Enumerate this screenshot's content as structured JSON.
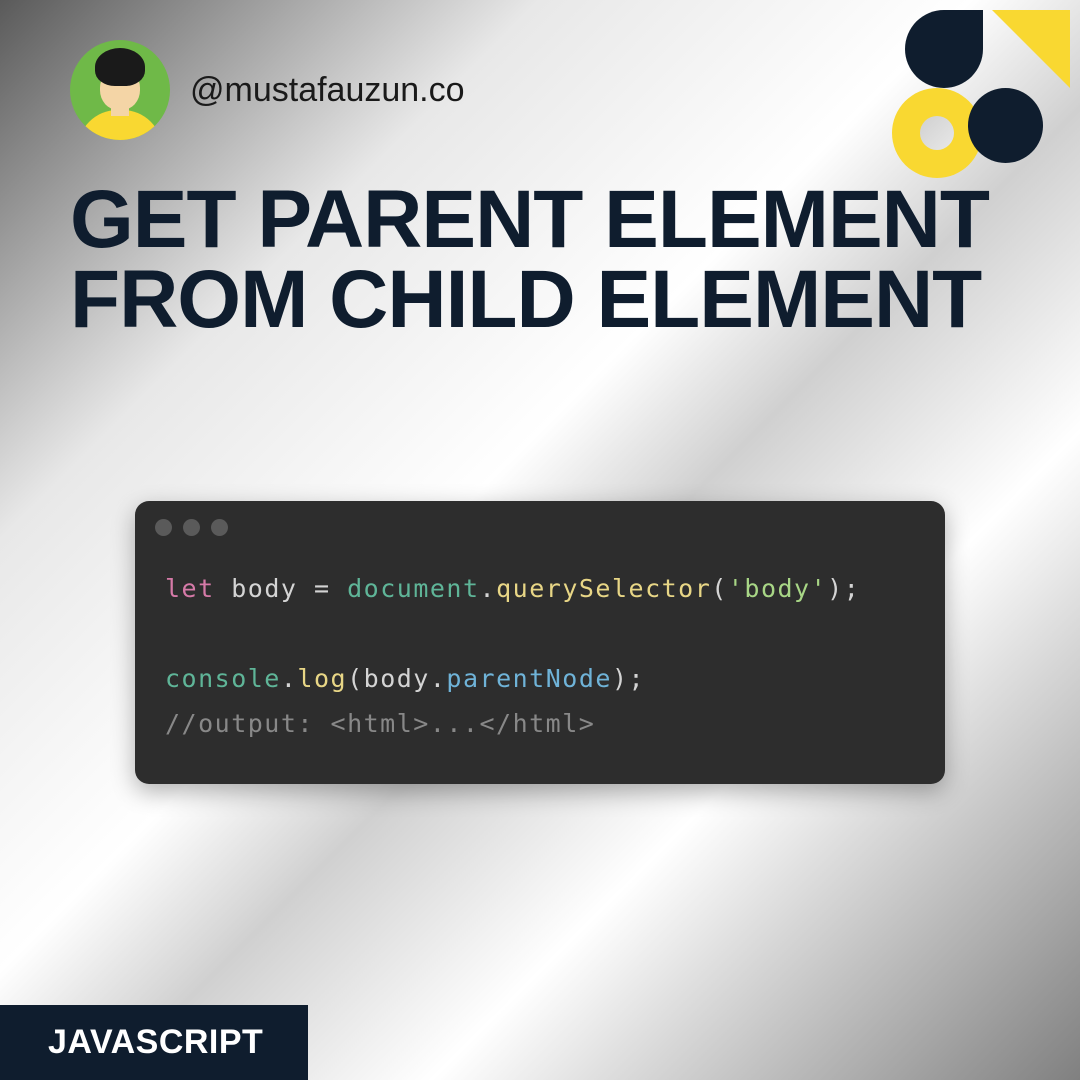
{
  "handle": "@mustafauzun.co",
  "title_line1": "GET PARENT ELEMENT",
  "title_line2": "FROM CHILD ELEMENT",
  "code": {
    "line1": {
      "keyword": "let",
      "variable": "body",
      "operator": "=",
      "object": "document",
      "method": "querySelector",
      "string": "'body'",
      "semi": ";"
    },
    "line2": {
      "object": "console",
      "method": "log",
      "arg_var": "body",
      "arg_prop": "parentNode",
      "semi": ";"
    },
    "line3": {
      "comment": "//output: <html>...</html>"
    }
  },
  "footer": "JAVASCRIPT"
}
